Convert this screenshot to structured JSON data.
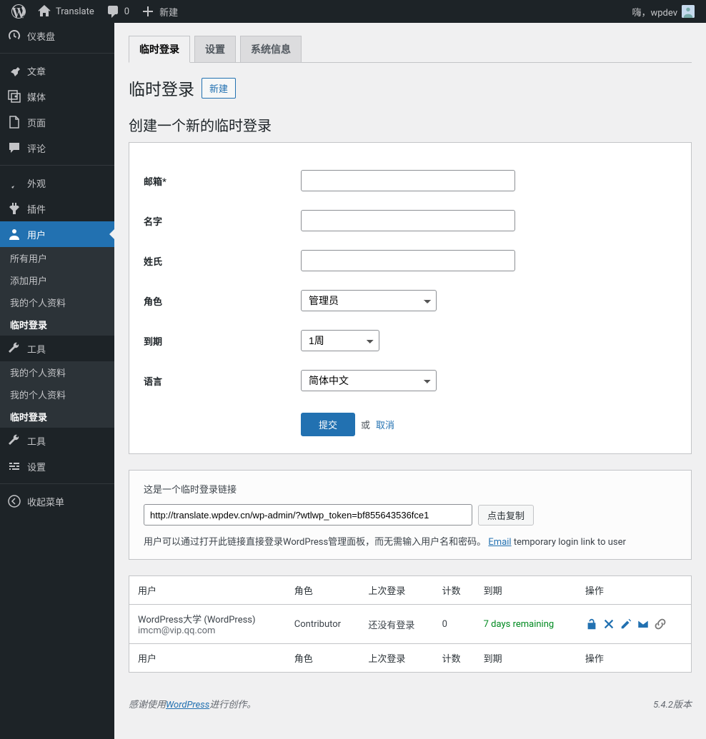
{
  "adminbar": {
    "site_title": "Translate",
    "comments_count": "0",
    "new_label": "新建",
    "howdy": "嗨，wpdev"
  },
  "sidebar": {
    "items": [
      {
        "icon": "dashboard",
        "label": "仪表盘"
      },
      {
        "icon": "pin",
        "label": "文章"
      },
      {
        "icon": "media",
        "label": "媒体"
      },
      {
        "icon": "page",
        "label": "页面"
      },
      {
        "icon": "comment",
        "label": "评论"
      },
      {
        "icon": "appearance",
        "label": "外观"
      },
      {
        "icon": "plugin",
        "label": "插件"
      },
      {
        "icon": "user",
        "label": "用户",
        "active": true
      },
      {
        "icon": "tool",
        "label": "工具"
      },
      {
        "icon": "tool",
        "label": "工具"
      },
      {
        "icon": "settings",
        "label": "设置"
      }
    ],
    "submenu": {
      "all_users": "所有用户",
      "add_user": "添加用户",
      "profile": "我的个人资料",
      "temp_login": "临时登录"
    },
    "extra": {
      "profile1": "我的个人资料",
      "profile2": "我的个人资料",
      "temp_login": "临时登录"
    },
    "collapse": "收起菜单"
  },
  "tabs": {
    "temp_login": "临时登录",
    "settings": "设置",
    "system_info": "系统信息"
  },
  "heading": {
    "title": "临时登录",
    "new_btn": "新建",
    "subtitle": "创建一个新的临时登录"
  },
  "form": {
    "email_label": "邮箱*",
    "name_label": "名字",
    "surname_label": "姓氏",
    "role_label": "角色",
    "role_value": "管理员",
    "expiry_label": "到期",
    "expiry_value": "1周",
    "lang_label": "语言",
    "lang_value": "简体中文",
    "submit": "提交",
    "or": "或",
    "cancel": "取消"
  },
  "link_box": {
    "title": "这是一个临时登录链接",
    "url": "http://translate.wpdev.cn/wp-admin/?wtlwp_token=bf855643536fce1",
    "copy_btn": "点击复制",
    "desc_prefix": "用户可以通过打开此链接直接登录WordPress管理面板，而无需输入用户名和密码。",
    "email_link": "Email",
    "desc_suffix": "temporary login link to user"
  },
  "table": {
    "headers": {
      "user": "用户",
      "role": "角色",
      "last_login": "上次登录",
      "count": "计数",
      "expiry": "到期",
      "actions": "操作"
    },
    "row": {
      "user_name": "WordPress大学 (WordPress)",
      "user_email": "imcm@vip.qq.com",
      "role": "Contributor",
      "last_login": "还没有登录",
      "count": "0",
      "expiry": "7 days remaining"
    }
  },
  "footer": {
    "thanks_prefix": "感谢使用",
    "wp_link": "WordPress",
    "thanks_suffix": "进行创作。",
    "version": "5.4.2版本"
  }
}
